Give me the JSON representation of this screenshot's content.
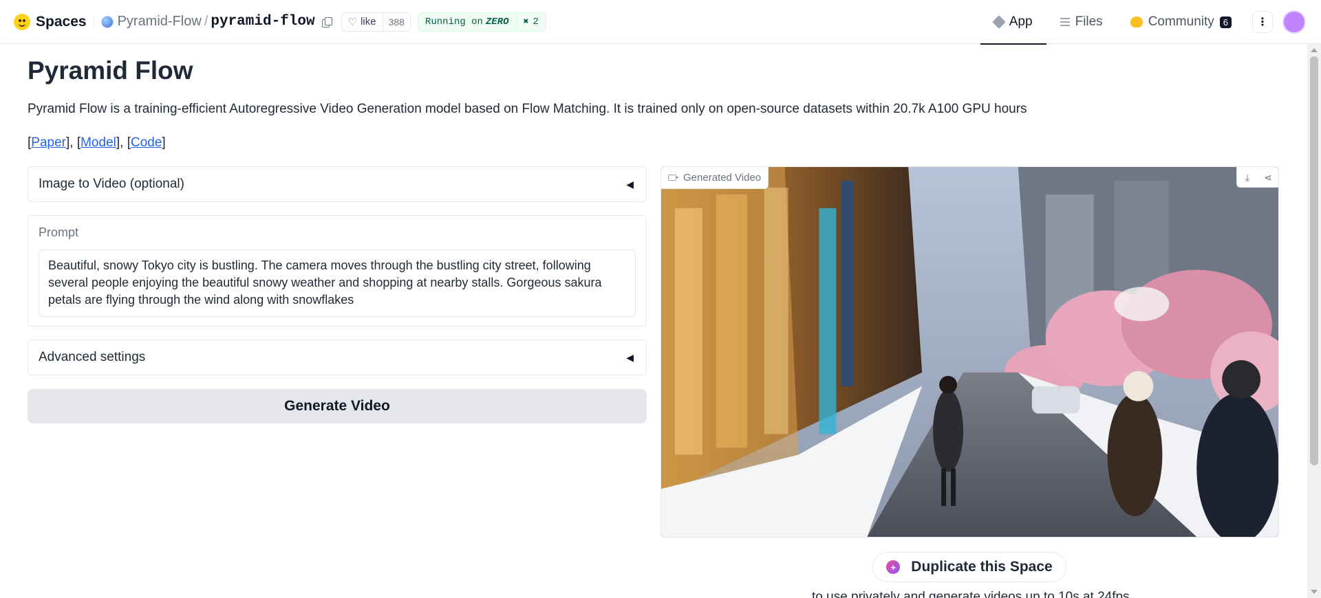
{
  "header": {
    "brand": "Spaces",
    "org": "Pyramid-Flow",
    "separator": "/",
    "space_name": "pyramid-flow",
    "like_label": "like",
    "like_count": "388",
    "status_prefix": "Running on",
    "status_hardware": "ZERO",
    "hardware_count": "2",
    "nav": {
      "app": "App",
      "files": "Files",
      "community": "Community",
      "community_count": "6"
    }
  },
  "main": {
    "title": "Pyramid Flow",
    "description": "Pyramid Flow is a training-efficient Autoregressive Video Generation model based on Flow Matching. It is trained only on open-source datasets within 20.7k A100 GPU hours",
    "links": {
      "paper": "Paper",
      "model": "Model",
      "code": "Code"
    },
    "image_to_video_label": "Image to Video (optional)",
    "prompt_label": "Prompt",
    "prompt_value": "Beautiful, snowy Tokyo city is bustling. The camera moves through the bustling city street, following several people enjoying the beautiful snowy weather and shopping at nearby stalls. Gorgeous sakura petals are flying through the wind along with snowflakes",
    "advanced_label": "Advanced settings",
    "generate_label": "Generate Video",
    "video_label": "Generated Video",
    "duplicate_label": "Duplicate this Space",
    "duplicate_note": "to use privately and generate videos up to 10s at 24fps"
  },
  "colors": {
    "accent_link": "#2563eb",
    "status_green": "#065f46",
    "button_gray": "#e5e7eb"
  },
  "icons": {
    "brand": "hugging-face-icon",
    "copy": "copy-icon",
    "like": "heart-icon",
    "hardware": "chip-icon",
    "collapse": "triangle-left-icon",
    "video": "camera-icon",
    "download": "download-icon",
    "share": "share-icon"
  }
}
